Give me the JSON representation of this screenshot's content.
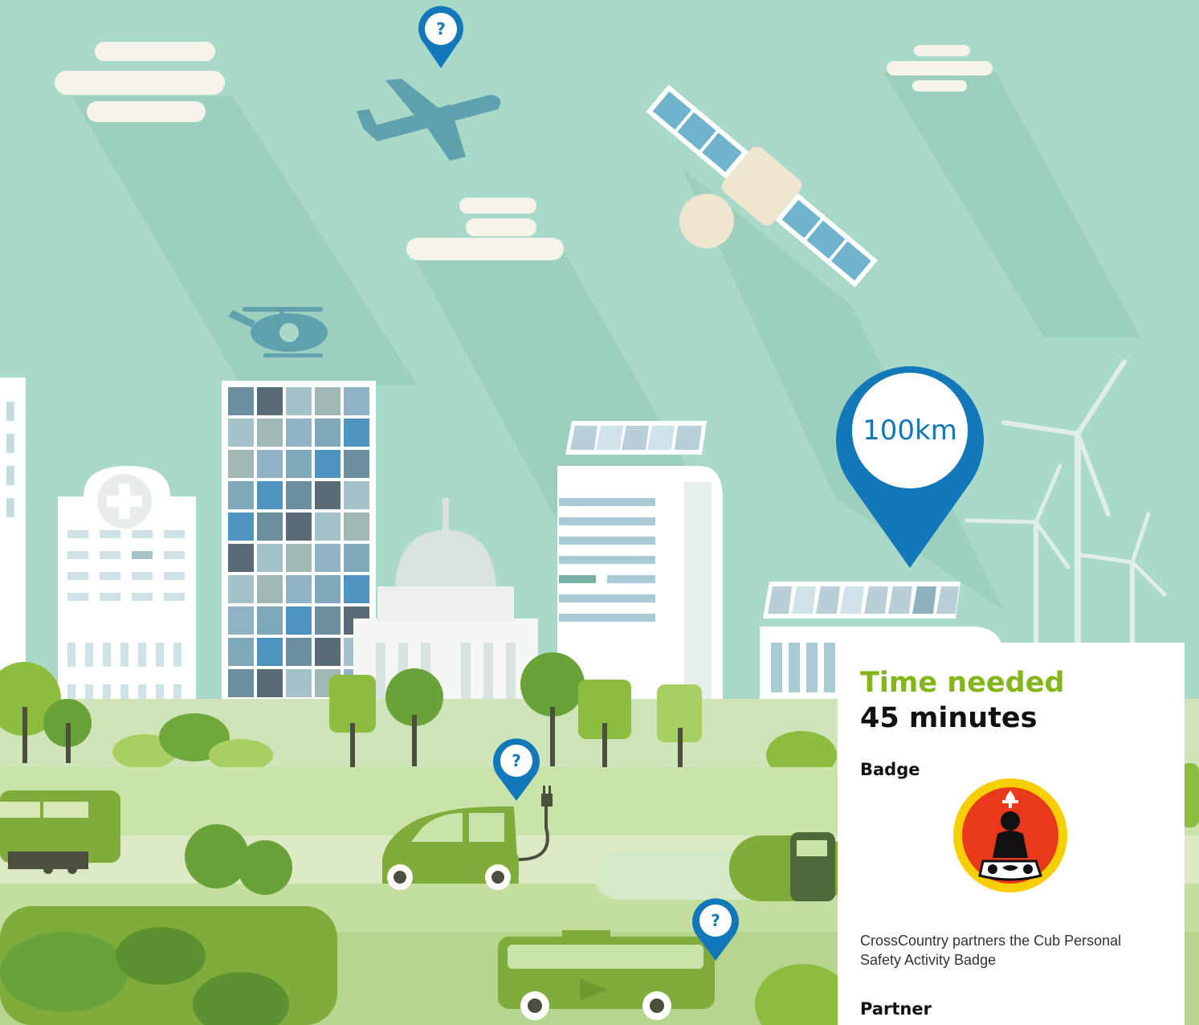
{
  "pins": {
    "plane": "?",
    "car": "?",
    "bus": "?",
    "distance": "100km"
  },
  "card": {
    "title": "Time needed",
    "time": "45 minutes",
    "badge_heading": "Badge",
    "badge_icon": "personal-safety-badge-icon",
    "description": "CrossCountry partners the Cub Personal Safety Activity Badge",
    "partner_heading": "Partner"
  },
  "colors": {
    "sky": "#a9d9c8",
    "pin_blue": "#1278b9",
    "title_green": "#84b51a",
    "badge_red": "#e8391b",
    "badge_yellow": "#f7cf00"
  }
}
